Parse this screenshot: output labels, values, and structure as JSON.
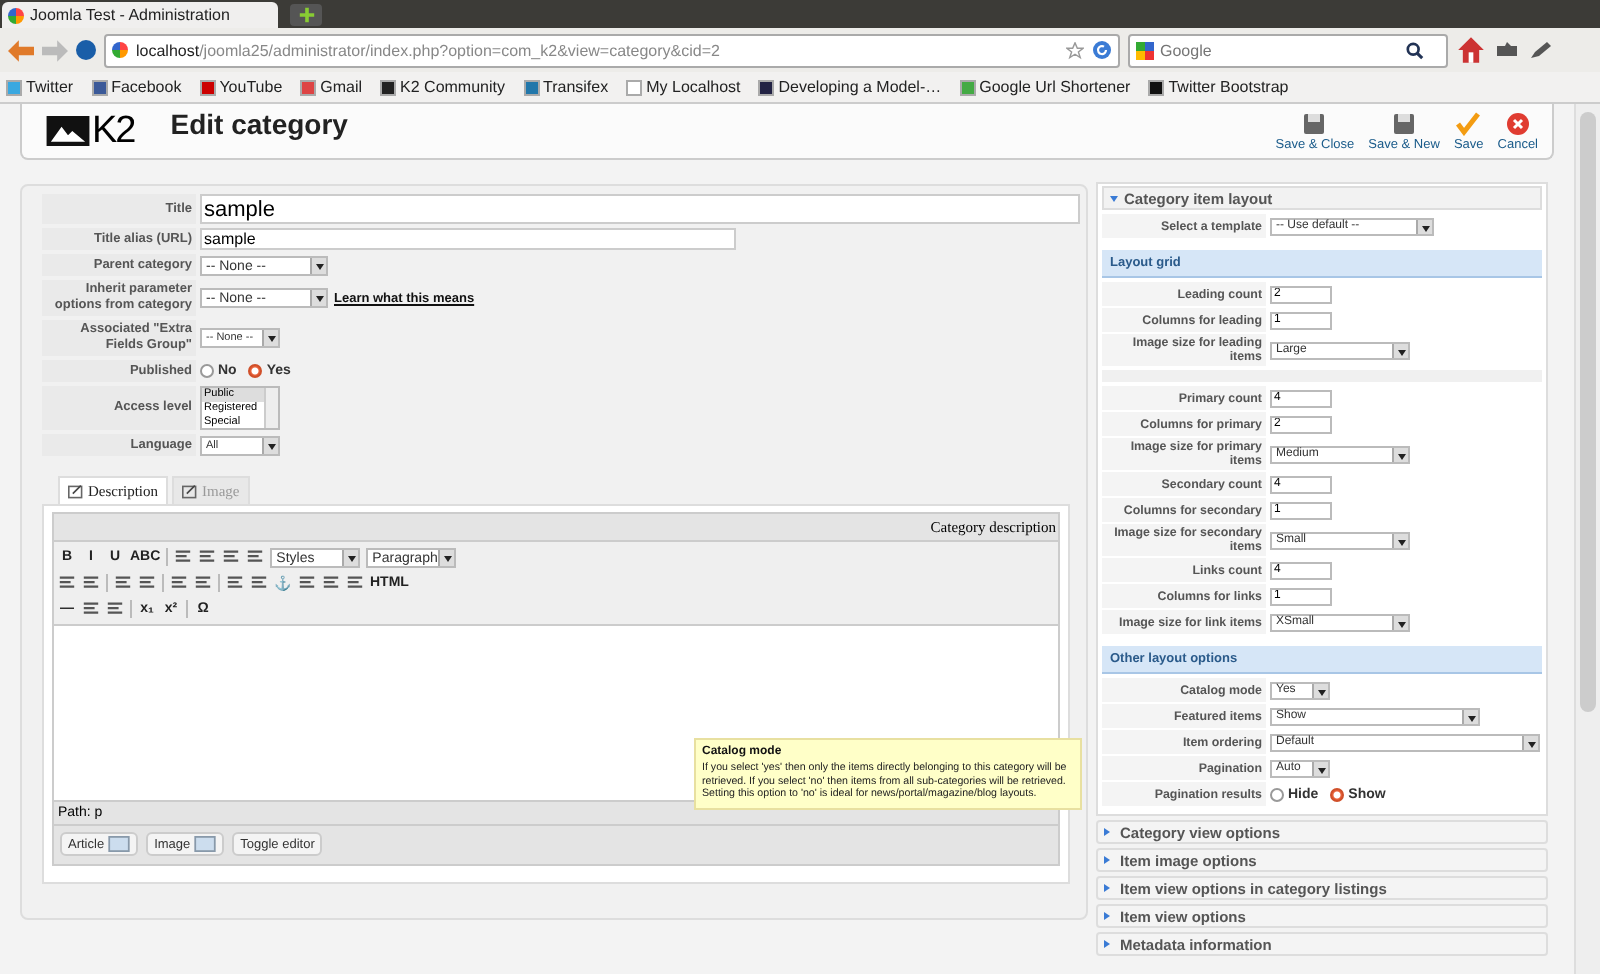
{
  "browser": {
    "tab_title": "Joomla Test - Administration",
    "url_host": "localhost",
    "url_path": "/joomla25/administrator/index.php?option=com_k2&view=category&cid=2",
    "search_placeholder": "Google",
    "bookmarks": [
      "Twitter",
      "Facebook",
      "YouTube",
      "Gmail",
      "K2 Community",
      "Transifex",
      "My Localhost",
      "Developing a Model-…",
      "Google Url Shortener",
      "Twitter Bootstrap"
    ]
  },
  "header": {
    "logo": "K2",
    "title": "Edit category",
    "actions": [
      "Save & Close",
      "Save & New",
      "Save",
      "Cancel"
    ]
  },
  "form": [
    {
      "kind": "text-large",
      "label": "Title",
      "value": "sample"
    },
    {
      "kind": "text",
      "label": "Title alias (URL)",
      "value": "sample"
    },
    {
      "kind": "select",
      "label": "Parent category",
      "value": "-- None --"
    },
    {
      "kind": "select",
      "label": "Inherit parameter options from category",
      "value": "-- None --",
      "link": "Learn what this means"
    },
    {
      "kind": "select-small",
      "label": "Associated \"Extra Fields Group\"",
      "value": "-- None --"
    },
    {
      "kind": "radio",
      "label": "Published",
      "options": [
        {
          "label": "No",
          "selected": false
        },
        {
          "label": "Yes",
          "selected": true
        }
      ]
    },
    {
      "kind": "listbox",
      "label": "Access level",
      "options": [
        {
          "label": "Public",
          "selected": true
        },
        {
          "label": "Registered",
          "selected": false
        },
        {
          "label": "Special",
          "selected": false
        }
      ]
    },
    {
      "kind": "select-small",
      "label": "Language",
      "value": "All"
    }
  ],
  "editor": {
    "tabs": [
      {
        "label": "Description",
        "selected": true
      },
      {
        "label": "Image",
        "selected": false
      }
    ],
    "caption": "Category description",
    "toolbar": [
      [
        {
          "kind": "glyph",
          "text": "B"
        },
        {
          "kind": "glyph",
          "text": "I"
        },
        {
          "kind": "glyph",
          "text": "U"
        },
        {
          "kind": "glyph",
          "text": "ABC"
        },
        {
          "kind": "sep"
        },
        {
          "kind": "icon"
        },
        {
          "kind": "icon"
        },
        {
          "kind": "icon"
        },
        {
          "kind": "icon"
        },
        {
          "kind": "select",
          "text": "Styles"
        },
        {
          "kind": "select",
          "text": "Paragraph"
        }
      ],
      [
        {
          "kind": "icon"
        },
        {
          "kind": "icon"
        },
        {
          "kind": "sep"
        },
        {
          "kind": "icon"
        },
        {
          "kind": "icon"
        },
        {
          "kind": "sep"
        },
        {
          "kind": "icon"
        },
        {
          "kind": "icon"
        },
        {
          "kind": "sep"
        },
        {
          "kind": "icon"
        },
        {
          "kind": "icon"
        },
        {
          "kind": "glyph",
          "text": "⚓"
        },
        {
          "kind": "icon"
        },
        {
          "kind": "icon"
        },
        {
          "kind": "icon"
        },
        {
          "kind": "glyph",
          "text": "HTML"
        }
      ],
      [
        {
          "kind": "glyph",
          "text": "—"
        },
        {
          "kind": "icon"
        },
        {
          "kind": "icon"
        },
        {
          "kind": "sep"
        },
        {
          "kind": "glyph",
          "text": "x₁"
        },
        {
          "kind": "glyph",
          "text": "x²"
        },
        {
          "kind": "sep"
        },
        {
          "kind": "glyph",
          "text": "Ω"
        }
      ]
    ],
    "path": "Path: p",
    "buttons": [
      "Article",
      "Image",
      "Toggle editor"
    ]
  },
  "tooltip": {
    "title": "Catalog mode",
    "text": "If you select 'yes' then only the items directly belonging to this category will be retrieved. If you select 'no' then items from all sub-categories will be retrieved. Setting this option to 'no' is ideal for news/portal/magazine/blog layouts."
  },
  "panel": {
    "title": "Category item layout",
    "expanded": true,
    "rows": [
      {
        "kind": "select",
        "label": "Select a template",
        "value": "-- Use default --"
      }
    ],
    "sections": [
      {
        "title": "Layout grid",
        "groups": [
          [
            {
              "kind": "input",
              "label": "Leading count",
              "value": "2"
            },
            {
              "kind": "input",
              "label": "Columns for leading",
              "value": "1"
            },
            {
              "kind": "select",
              "label": "Image size for leading items",
              "value": "Large"
            }
          ],
          [
            {
              "kind": "input",
              "label": "Primary count",
              "value": "4"
            },
            {
              "kind": "input",
              "label": "Columns for primary",
              "value": "2"
            },
            {
              "kind": "select",
              "label": "Image size for primary items",
              "value": "Medium"
            },
            {
              "kind": "input",
              "label": "Secondary count",
              "value": "4"
            },
            {
              "kind": "input",
              "label": "Columns for secondary",
              "value": "1"
            },
            {
              "kind": "select",
              "label": "Image size for secondary items",
              "value": "Small"
            },
            {
              "kind": "input",
              "label": "Links count",
              "value": "4"
            },
            {
              "kind": "input",
              "label": "Columns for links",
              "value": "1"
            },
            {
              "kind": "select",
              "label": "Image size for link items",
              "value": "XSmall"
            }
          ]
        ]
      },
      {
        "title": "Other layout options",
        "groups": [
          [
            {
              "kind": "select-tiny",
              "label": "Catalog mode",
              "value": "Yes"
            },
            {
              "kind": "select-wide",
              "label": "Featured items",
              "value": "Show"
            },
            {
              "kind": "select-wider",
              "label": "Item ordering",
              "value": "Default"
            },
            {
              "kind": "select-tiny",
              "label": "Pagination",
              "value": "Auto"
            },
            {
              "kind": "radio",
              "label": "Pagination results",
              "options": [
                {
                  "label": "Hide",
                  "selected": false
                },
                {
                  "label": "Show",
                  "selected": true
                }
              ]
            }
          ]
        ]
      }
    ]
  },
  "collapsed_panels": [
    {
      "title": "Category view options",
      "expanded": false
    },
    {
      "title": "Item image options",
      "expanded": false
    },
    {
      "title": "Item view options in category listings",
      "expanded": false
    },
    {
      "title": "Item view options",
      "expanded": false
    },
    {
      "title": "Metadata information",
      "expanded": false
    }
  ]
}
